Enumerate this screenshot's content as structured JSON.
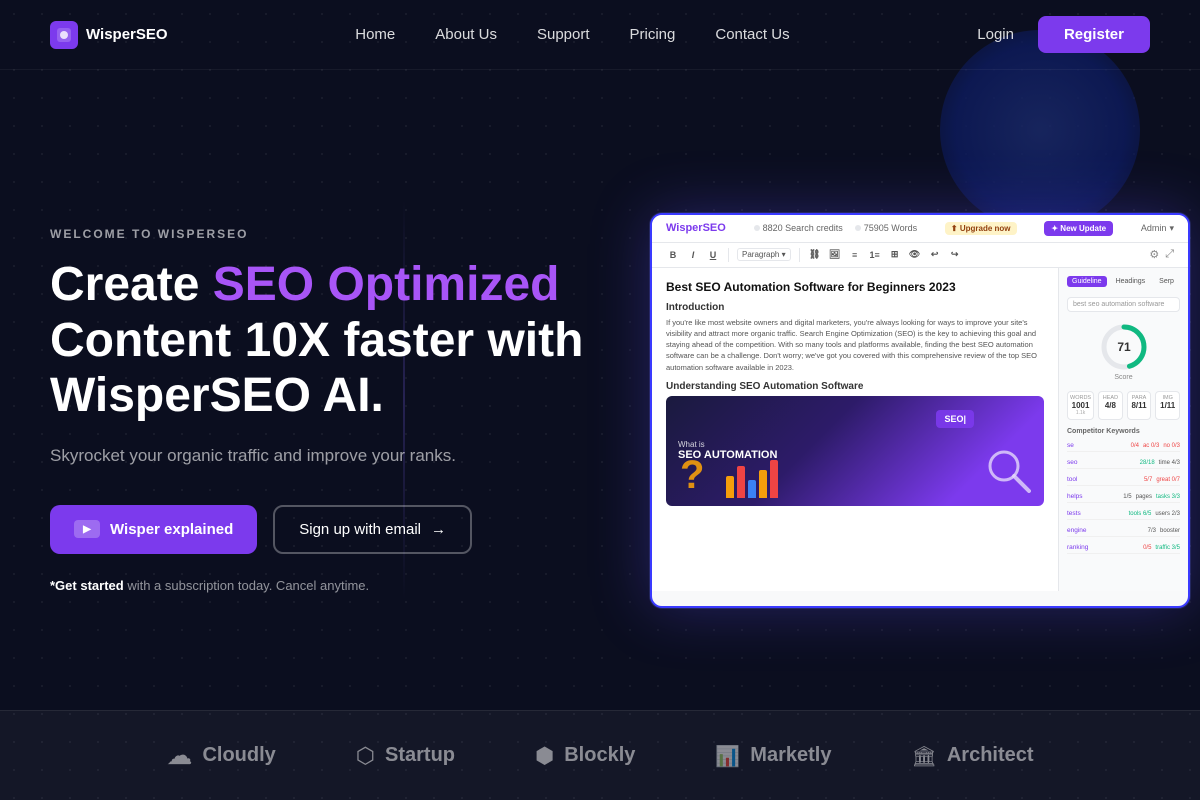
{
  "nav": {
    "logo_text": "WisperSEO",
    "links": [
      {
        "label": "Home",
        "href": "#"
      },
      {
        "label": "About Us",
        "href": "#"
      },
      {
        "label": "Support",
        "href": "#"
      },
      {
        "label": "Pricing",
        "href": "#"
      },
      {
        "label": "Contact Us",
        "href": "#"
      }
    ],
    "login_label": "Login",
    "register_label": "Register"
  },
  "hero": {
    "welcome_text": "WELCOME TO WISPERSEO",
    "title_part1": "Create ",
    "title_highlight": "SEO Optimized",
    "title_part2": " Content 10X faster with WisperSEO AI.",
    "subtitle": "Skyrocket your organic traffic and improve your ranks.",
    "btn_primary_label": "Wisper explained",
    "btn_secondary_label": "Sign up with email",
    "footnote_bold": "*Get started",
    "footnote_rest": " with a subscription today. Cancel anytime."
  },
  "mockup": {
    "logo": "WisperSEO",
    "credits": "8820 Search credits",
    "words": "75905 Words",
    "upgrade": "⬆ Upgrade now",
    "new_update": "✦ New Update",
    "admin": "Admin",
    "article_title": "Best SEO Automation Software for Beginners 2023",
    "intro_heading": "Introduction",
    "intro_text": "If you're like most website owners and digital marketers, you're always looking for ways to improve your site's visibility and attract more organic traffic. Search Engine Optimization (SEO) is the key to achieving this goal and staying ahead of the competition. With so many tools and platforms available, finding the best SEO automation software can be a challenge. Don't worry; we've got you covered with this comprehensive review of the top SEO automation software available in 2023.",
    "subheading": "Understanding SEO Automation Software",
    "image_line1": "What is",
    "image_line2": "SEO AUTOMATION",
    "seo_badge": "SEO|",
    "score": "71",
    "score_label": "Score",
    "panel_tabs": [
      "Guideline",
      "Headings",
      "Serp"
    ],
    "search_placeholder": "best seo automation software",
    "stats": [
      {
        "label": "WORDS",
        "value": "1000/1.1",
        "sub": ""
      },
      {
        "label": "HEADINGS",
        "value": "4/8",
        "sub": ""
      },
      {
        "label": "PARAGRAPHS",
        "value": "8/11",
        "sub": ""
      },
      {
        "label": "IMAGES",
        "value": "1/11",
        "sub": ""
      }
    ],
    "competitor_label": "Competitor Keywords",
    "keywords": [
      {
        "name": "se",
        "v1": "0/4",
        "v2": "ac 0/3",
        "v3": "no 0/3"
      },
      {
        "name": "seo",
        "v1": "28/18",
        "v2": "time 4/3",
        "v3": ""
      },
      {
        "name": "tool",
        "v1": "5/7",
        "v2": "great 0/7",
        "v3": ""
      },
      {
        "name": "helps",
        "v1": "1/5",
        "v2": "pages",
        "v3": "tasks 3/3"
      },
      {
        "name": "tests",
        "v1": "tools 6/5",
        "v2": "users 2/3",
        "v3": ""
      },
      {
        "name": "engine",
        "v1": "7/3",
        "v2": "booster",
        "v3": ""
      },
      {
        "name": "ranking",
        "v1": "0/5",
        "v2": "traffic 3/5",
        "v3": ""
      }
    ]
  },
  "brands": [
    {
      "icon": "icon-cloudly",
      "name": "Cloudly"
    },
    {
      "icon": "icon-startup",
      "name": "Startup"
    },
    {
      "icon": "icon-blockly",
      "name": "Blockly"
    },
    {
      "icon": "icon-marketly",
      "name": "Marketly"
    },
    {
      "icon": "icon-architect",
      "name": "Architect"
    }
  ]
}
